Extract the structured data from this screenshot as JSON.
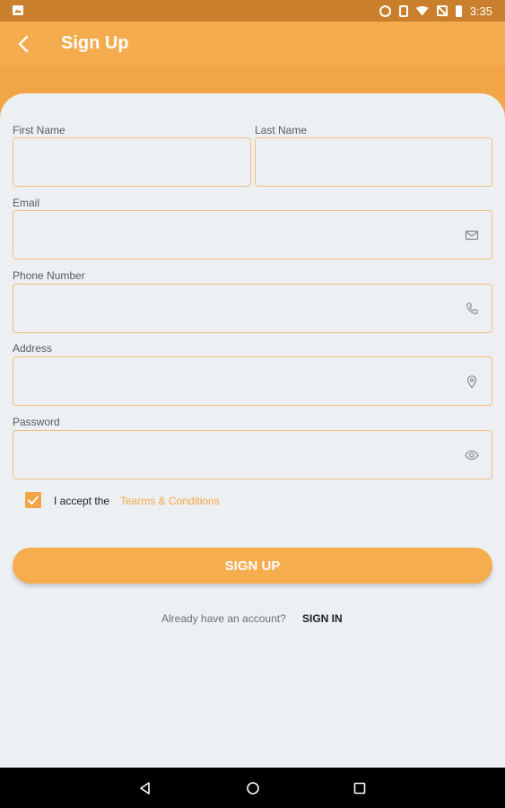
{
  "status_bar": {
    "time": "3:35"
  },
  "app_bar": {
    "title": "Sign Up"
  },
  "form": {
    "first_name": {
      "label": "First Name",
      "value": ""
    },
    "last_name": {
      "label": "Last Name",
      "value": ""
    },
    "email": {
      "label": "Email",
      "value": ""
    },
    "phone": {
      "label": "Phone Number",
      "value": ""
    },
    "address": {
      "label": "Address",
      "value": ""
    },
    "password": {
      "label": "Password",
      "value": ""
    }
  },
  "terms": {
    "checked": true,
    "accept_text": "I accept the",
    "link_text": "Tearms & Conditions"
  },
  "signup_button": {
    "label": "SIGN UP"
  },
  "footer": {
    "already_text": "Already have an account?",
    "signin_label": "SIGN IN"
  },
  "colors": {
    "accent": "#f2a545",
    "status_bar": "#c97f2c",
    "field_border": "#f2c07a",
    "card_background": "#edf0f2"
  },
  "icons": {
    "email": "envelope-icon",
    "phone": "phone-icon",
    "address": "location-pin-icon",
    "password": "eye-icon"
  }
}
